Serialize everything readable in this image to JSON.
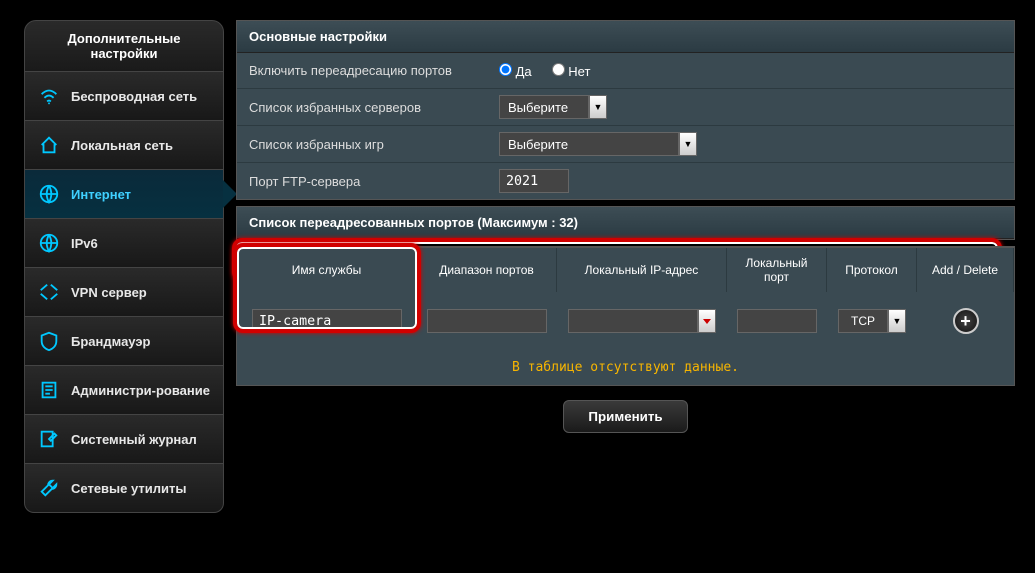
{
  "sidebar": {
    "title": "Дополнительные настройки",
    "items": [
      {
        "label": "Беспроводная сеть"
      },
      {
        "label": "Локальная сеть"
      },
      {
        "label": "Интернет"
      },
      {
        "label": "IPv6"
      },
      {
        "label": "VPN сервер"
      },
      {
        "label": "Брандмауэр"
      },
      {
        "label": "Администри-рование"
      },
      {
        "label": "Системный журнал"
      },
      {
        "label": "Сетевые утилиты"
      }
    ]
  },
  "main": {
    "section_title": "Основные настройки",
    "enable_forward_label": "Включить переадресацию портов",
    "yes": "Да",
    "no": "Нет",
    "fav_servers_label": "Список избранных серверов",
    "fav_games_label": "Список избранных игр",
    "select_placeholder": "Выберите",
    "ftp_port_label": "Порт FTP-сервера",
    "ftp_port_value": "2021",
    "port_list_title": "Список переадресованных портов (Максимум : 32)",
    "columns": {
      "service": "Имя службы",
      "port_range": "Диапазон портов",
      "local_ip": "Локальный IP-адрес",
      "local_port": "Локальный порт",
      "protocol": "Протокол",
      "add_del": "Add / Delete"
    },
    "new_row": {
      "service_name": "IP-camera",
      "protocol": "TCP"
    },
    "empty_table_msg": "В таблице отсутствуют данные.",
    "apply_button": "Применить"
  }
}
